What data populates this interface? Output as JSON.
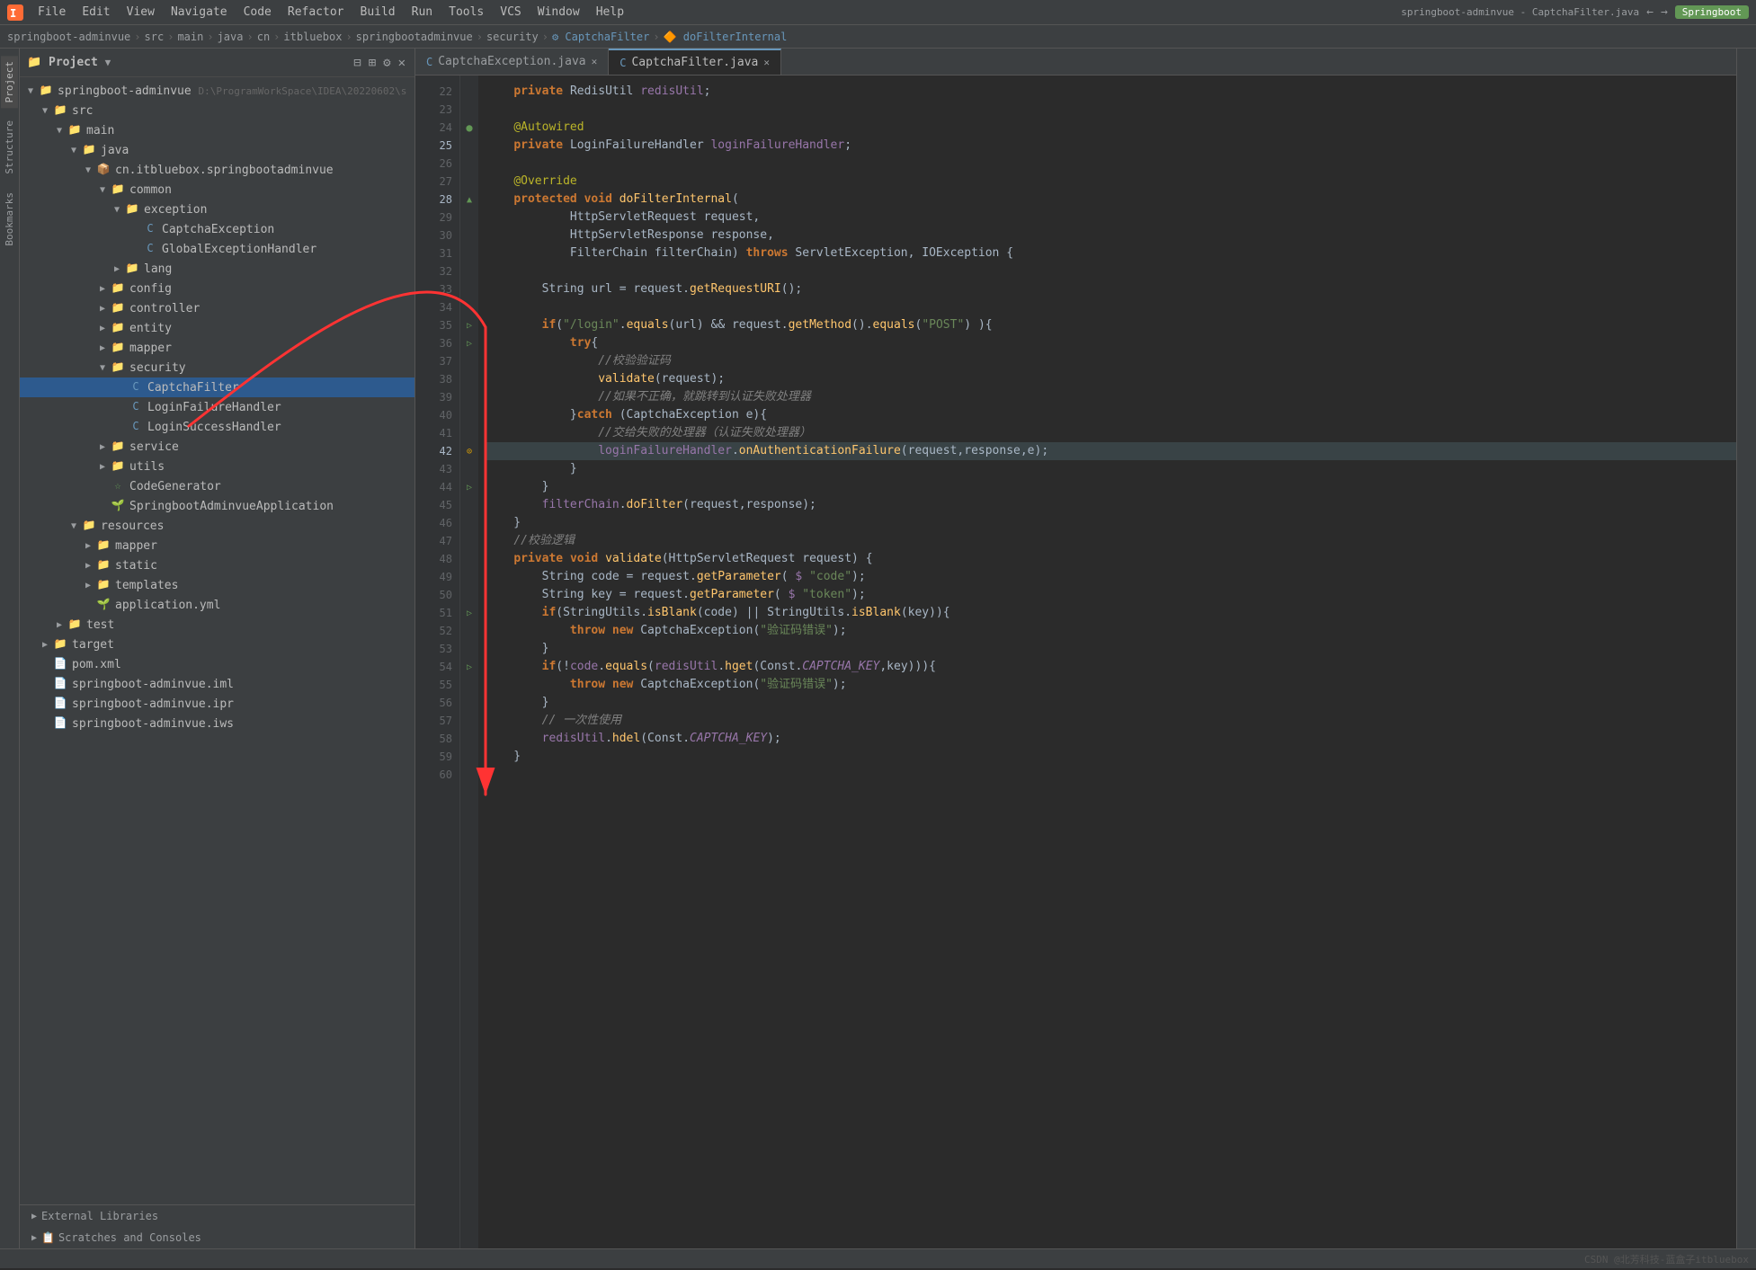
{
  "window": {
    "title": "springboot-adminvue - CaptchaFilter.java",
    "app_name": "IntelliJ IDEA"
  },
  "menu": {
    "items": [
      "File",
      "Edit",
      "View",
      "Navigate",
      "Code",
      "Refactor",
      "Build",
      "Run",
      "Tools",
      "VCS",
      "Window",
      "Help"
    ]
  },
  "breadcrumb": {
    "items": [
      "springboot-adminvue",
      "src",
      "main",
      "java",
      "cn",
      "itbluebox",
      "springbootadminvue",
      "security",
      "CaptchaFilter",
      "doFilterInternal"
    ]
  },
  "tabs": [
    {
      "label": "CaptchaException.java",
      "icon": "C",
      "active": false
    },
    {
      "label": "CaptchaFilter.java",
      "icon": "C",
      "active": true
    }
  ],
  "sidebar": {
    "title": "Project",
    "tree": [
      {
        "level": 0,
        "label": "springboot-adminvue",
        "type": "project",
        "extra": "D:\\ProgramWorkSpace\\IDEA\\20220602\\s",
        "expanded": true
      },
      {
        "level": 1,
        "label": "src",
        "type": "folder",
        "expanded": true
      },
      {
        "level": 2,
        "label": "main",
        "type": "folder",
        "expanded": true
      },
      {
        "level": 3,
        "label": "java",
        "type": "folder",
        "expanded": true
      },
      {
        "level": 4,
        "label": "cn.itbluebox.springbootadminvue",
        "type": "package",
        "expanded": true
      },
      {
        "level": 5,
        "label": "common",
        "type": "folder",
        "expanded": true
      },
      {
        "level": 6,
        "label": "exception",
        "type": "folder",
        "expanded": true
      },
      {
        "level": 7,
        "label": "CaptchaException",
        "type": "class",
        "expanded": false
      },
      {
        "level": 7,
        "label": "GlobalExceptionHandler",
        "type": "class",
        "expanded": false
      },
      {
        "level": 6,
        "label": "lang",
        "type": "folder",
        "expanded": false
      },
      {
        "level": 5,
        "label": "config",
        "type": "folder",
        "expanded": false
      },
      {
        "level": 5,
        "label": "controller",
        "type": "folder",
        "expanded": false
      },
      {
        "level": 5,
        "label": "entity",
        "type": "folder",
        "expanded": false
      },
      {
        "level": 5,
        "label": "mapper",
        "type": "folder",
        "expanded": false
      },
      {
        "level": 5,
        "label": "security",
        "type": "folder",
        "expanded": true,
        "selected": false
      },
      {
        "level": 6,
        "label": "CaptchaFilter",
        "type": "class",
        "selected": true
      },
      {
        "level": 6,
        "label": "LoginFailureHandler",
        "type": "class"
      },
      {
        "level": 6,
        "label": "LoginSuccessHandler",
        "type": "class"
      },
      {
        "level": 5,
        "label": "service",
        "type": "folder",
        "expanded": false
      },
      {
        "level": 5,
        "label": "utils",
        "type": "folder",
        "expanded": false
      },
      {
        "level": 4,
        "label": "CodeGenerator",
        "type": "class-green"
      },
      {
        "level": 4,
        "label": "SpringbootAdminvueApplication",
        "type": "springboot"
      },
      {
        "level": 3,
        "label": "resources",
        "type": "folder",
        "expanded": true
      },
      {
        "level": 4,
        "label": "mapper",
        "type": "folder",
        "expanded": false
      },
      {
        "level": 4,
        "label": "static",
        "type": "folder",
        "expanded": false
      },
      {
        "level": 4,
        "label": "templates",
        "type": "folder",
        "expanded": false
      },
      {
        "level": 4,
        "label": "application.yml",
        "type": "yaml"
      },
      {
        "level": 2,
        "label": "test",
        "type": "folder",
        "expanded": false
      },
      {
        "level": 1,
        "label": "target",
        "type": "folder-orange",
        "expanded": false
      },
      {
        "level": 1,
        "label": "pom.xml",
        "type": "xml"
      },
      {
        "level": 1,
        "label": "springboot-adminvue.iml",
        "type": "iml"
      },
      {
        "level": 1,
        "label": "springboot-adminvue.ipr",
        "type": "iml"
      },
      {
        "level": 1,
        "label": "springboot-adminvue.iws",
        "type": "iml"
      }
    ],
    "bottom_items": [
      {
        "label": "External Libraries"
      },
      {
        "label": "Scratches and Consoles"
      }
    ]
  },
  "code": {
    "lines": [
      {
        "num": 22,
        "content": "    private RedisUtil redisUtil;"
      },
      {
        "num": 23,
        "content": ""
      },
      {
        "num": 24,
        "content": "    @Autowired"
      },
      {
        "num": 25,
        "content": "    private LoginFailureHandler loginFailureHandler;"
      },
      {
        "num": 26,
        "content": ""
      },
      {
        "num": 27,
        "content": "    @Override"
      },
      {
        "num": 28,
        "content": "    protected void doFilterInternal("
      },
      {
        "num": 29,
        "content": "            HttpServletRequest request,"
      },
      {
        "num": 30,
        "content": "            HttpServletResponse response,"
      },
      {
        "num": 31,
        "content": "            FilterChain filterChain) throws ServletException, IOException {"
      },
      {
        "num": 32,
        "content": ""
      },
      {
        "num": 33,
        "content": "        String url = request.getRequestURI();"
      },
      {
        "num": 34,
        "content": ""
      },
      {
        "num": 35,
        "content": "        if(\"/login\".equals(url) && request.getMethod().equals(\"POST\") ){"
      },
      {
        "num": 36,
        "content": "            try{"
      },
      {
        "num": 37,
        "content": "                //校验验证码"
      },
      {
        "num": 38,
        "content": "                validate(request);"
      },
      {
        "num": 39,
        "content": "                //如果不正确，就跳转到认证失败处理器"
      },
      {
        "num": 40,
        "content": "            }catch (CaptchaException e){"
      },
      {
        "num": 41,
        "content": "                //交给失败的处理器（认证失败处理器）"
      },
      {
        "num": 42,
        "content": "                loginFailureHandler.onAuthenticationFailure(request,response,e);"
      },
      {
        "num": 43,
        "content": "            }"
      },
      {
        "num": 44,
        "content": "        }"
      },
      {
        "num": 45,
        "content": "        filterChain.doFilter(request,response);"
      },
      {
        "num": 46,
        "content": "    }"
      },
      {
        "num": 47,
        "content": "    //校验逻辑"
      },
      {
        "num": 48,
        "content": "    private void validate(HttpServletRequest request) {"
      },
      {
        "num": 49,
        "content": "        String code = request.getParameter( \\$ \"code\");"
      },
      {
        "num": 50,
        "content": "        String key = request.getParameter( \\$ \"token\");"
      },
      {
        "num": 51,
        "content": "        if(StringUtils.isBlank(code) || StringUtils.isBlank(key)){"
      },
      {
        "num": 52,
        "content": "            throw new CaptchaException(\"验证码错误\");"
      },
      {
        "num": 53,
        "content": "        }"
      },
      {
        "num": 54,
        "content": "        if(!code.equals(redisUtil.hget(Const.CAPTCHA_KEY,key))){"
      },
      {
        "num": 55,
        "content": "            throw new CaptchaException(\"验证码错误\");"
      },
      {
        "num": 56,
        "content": "        }"
      },
      {
        "num": 57,
        "content": "        // 一次性使用"
      },
      {
        "num": 58,
        "content": "        redisUtil.hdel(Const.CAPTCHA_KEY);"
      },
      {
        "num": 59,
        "content": "    }"
      },
      {
        "num": 60,
        "content": "}"
      }
    ]
  },
  "status_bar": {
    "right": "CSDN @北芳科技-蓝盒子itbluebox",
    "springboot": "Springboot"
  },
  "vertical_tabs": {
    "left": [
      "Project",
      "Structure",
      "Bookmarks"
    ],
    "right": []
  }
}
